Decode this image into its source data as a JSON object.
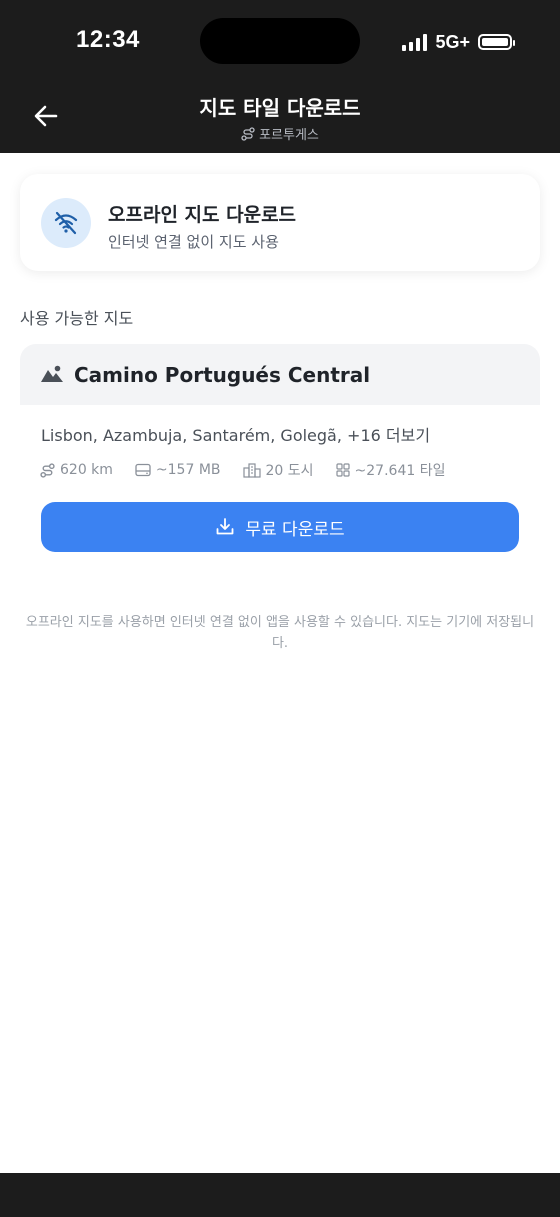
{
  "status_bar": {
    "time": "12:34",
    "network": "5G+"
  },
  "header": {
    "title": "지도 타일 다운로드",
    "subtitle": "포르투게스",
    "back_icon": "arrow-left-icon",
    "route_icon": "route-icon"
  },
  "offline_card": {
    "icon": "wifi-off-icon",
    "title": "오프라인 지도 다운로드",
    "description": "인터넷 연결 없이 지도 사용"
  },
  "section_label": "사용 가능한 지도",
  "maps": [
    {
      "icon": "mountain-icon",
      "name": "Camino Portugués Central",
      "places": "Lisbon, Azambuja, Santarém, Golegã, ",
      "places_more": "+16 더보기",
      "stats": {
        "distance": "620 km",
        "size": "~157 MB",
        "cities": "20 도시",
        "tiles": "~27.641 타일"
      },
      "download_label": "무료 다운로드"
    }
  ],
  "info_text": "오프라인 지도를 사용하면 인터넷 연결 없이 앱을 사용할 수 있습니다. 지도는 기기에 저장됩니다.",
  "colors": {
    "primary": "#3b82f2",
    "dark_bar": "#1c1c1c",
    "icon_bg": "#dcebfb"
  }
}
